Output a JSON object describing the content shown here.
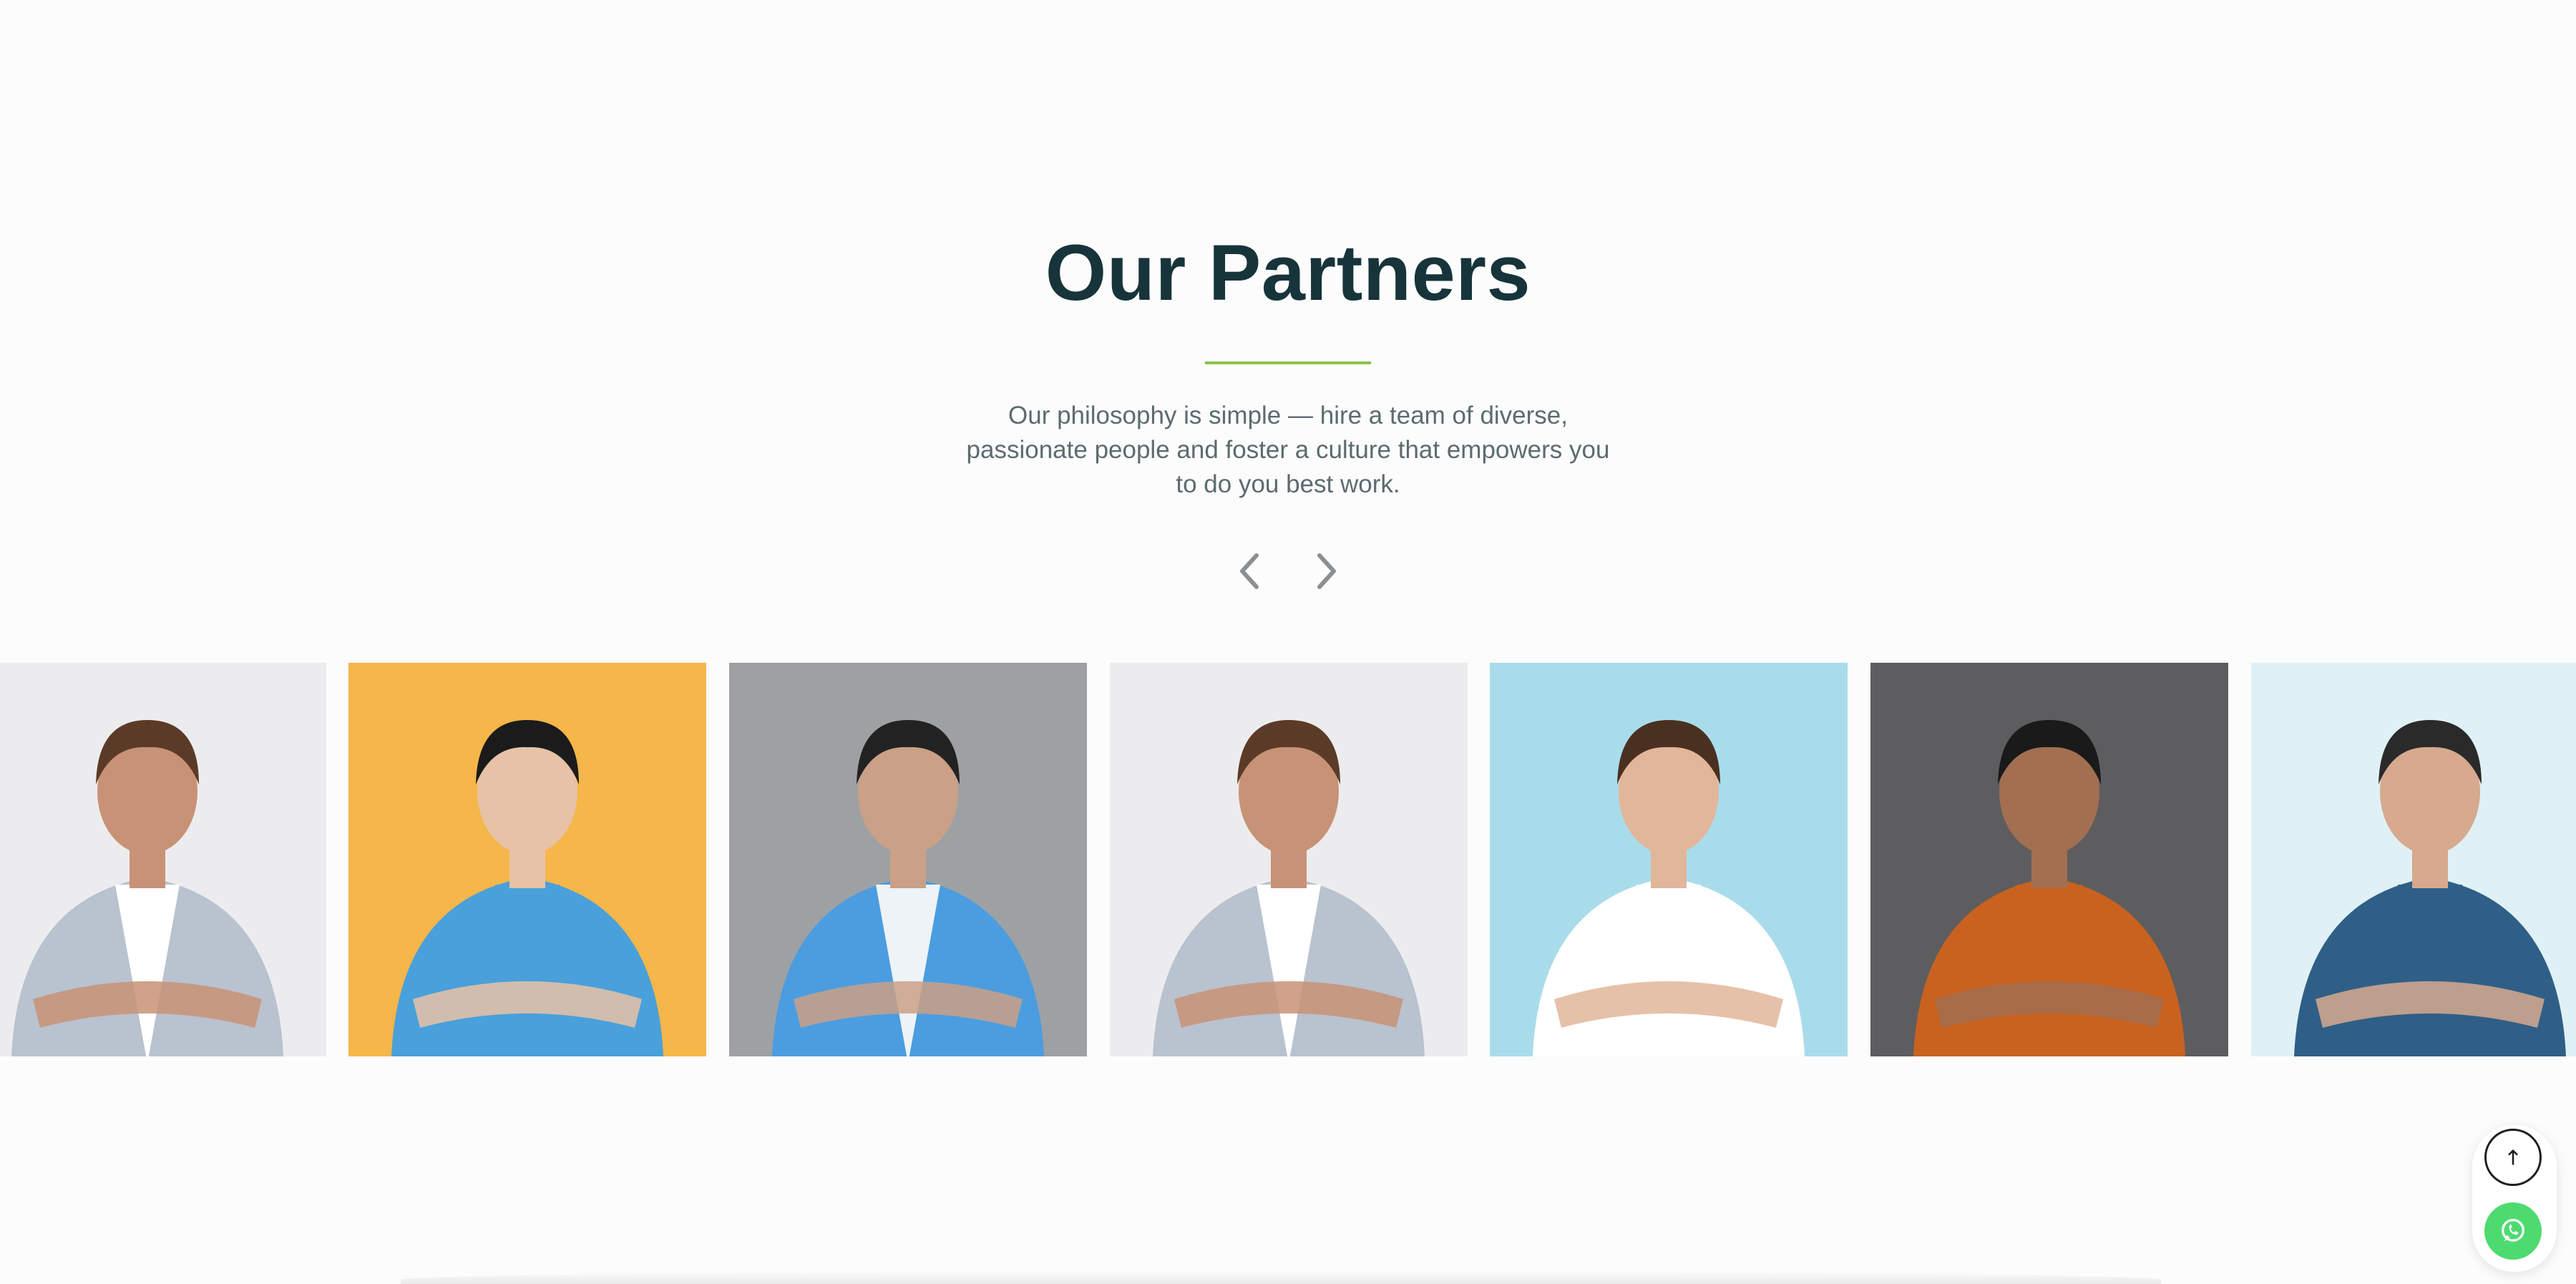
{
  "section": {
    "title": "Our Partners",
    "subtitle": "Our philosophy is simple — hire a team of diverse, passionate people and foster a culture that empowers you to do you best work."
  },
  "carousel": {
    "prev_icon": "chevron-left-icon",
    "next_icon": "chevron-right-icon",
    "cards": [
      {
        "bg": "#ececee",
        "shirt": "#b9c2cf",
        "inner": "#ffffff",
        "skin": "#c89276",
        "hair": "#5b3b27"
      },
      {
        "bg": "#f5b64a",
        "shirt": "#4aa0da",
        "inner": "#4aa0da",
        "skin": "#e7c2a6",
        "hair": "#1b1b1b"
      },
      {
        "bg": "#9ea1a3",
        "shirt": "#4b9de0",
        "inner": "#eef3f7",
        "skin": "#caa086",
        "hair": "#222222"
      },
      {
        "bg": "#ececee",
        "shirt": "#b9c2cf",
        "inner": "#ffffff",
        "skin": "#c89276",
        "hair": "#5b3b27"
      },
      {
        "bg": "#a9dcea",
        "shirt": "#ffffff",
        "inner": "#ffffff",
        "skin": "#e2b69a",
        "hair": "#4a3021"
      },
      {
        "bg": "#5d5d5f",
        "shirt": "#c9621f",
        "inner": "#c9621f",
        "skin": "#a36f51",
        "hair": "#1a1a1a"
      },
      {
        "bg": "#dff1f6",
        "shirt": "#2f5f86",
        "inner": "#2f5f86",
        "skin": "#d7a98e",
        "hair": "#2a2a2a"
      }
    ]
  },
  "floating": {
    "scroll_top_icon": "arrow-up-icon",
    "whatsapp_icon": "whatsapp-icon",
    "whatsapp_color": "#4ddb70"
  },
  "colors": {
    "title": "#16343a",
    "accent": "#8bc34a",
    "text": "#5c6b70"
  }
}
